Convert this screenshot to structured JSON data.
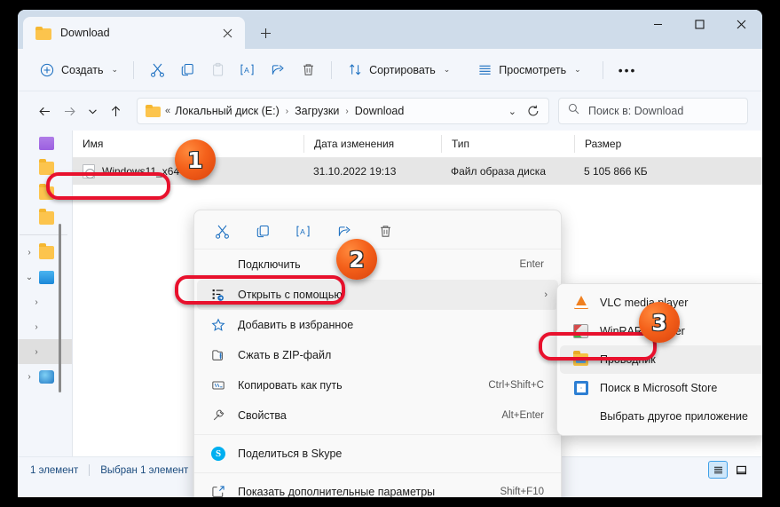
{
  "window": {
    "tab_title": "Download",
    "tab_close_label": "✕",
    "new_tab_label": "+",
    "minimize_label": "minimize",
    "maximize_label": "maximize",
    "close_label": "close"
  },
  "toolbar": {
    "new_label": "Создать",
    "cut_label": "cut-icon",
    "copy_label": "copy-icon",
    "paste_label": "paste-icon",
    "rename_label": "rename-icon",
    "share_label": "share-icon",
    "delete_label": "delete-icon",
    "sort_label": "Сортировать",
    "view_label": "Просмотреть",
    "more_label": "•••"
  },
  "address": {
    "crumbs": [
      "Локальный диск (E:)",
      "Загрузки",
      "Download"
    ],
    "overflow_label": "«",
    "separator": "›",
    "dropdown_caret": "⌄",
    "refresh_label": "refresh-icon"
  },
  "search": {
    "placeholder": "Поиск в: Download"
  },
  "columns": {
    "name": "Имя",
    "date": "Дата изменения",
    "type": "Тип",
    "size": "Размер"
  },
  "files": [
    {
      "name": "Windows11_x64",
      "date": "31.10.2022 19:13",
      "type": "Файл образа диска",
      "size": "5 105 866 КБ"
    }
  ],
  "context_menu": {
    "quick_actions": [
      "cut-icon",
      "copy-icon",
      "rename-icon",
      "share-icon",
      "delete-icon"
    ],
    "items": [
      {
        "label": "Подключить",
        "shortcut": "Enter",
        "icon": "",
        "arrow": "",
        "highlight": false
      },
      {
        "label": "Открыть с помощью",
        "shortcut": "",
        "icon": "open-with-icon",
        "arrow": "›",
        "highlight": true
      },
      {
        "label": "Добавить в избранное",
        "shortcut": "",
        "icon": "star-icon",
        "arrow": "",
        "highlight": false
      },
      {
        "label": "Сжать в ZIP-файл",
        "shortcut": "",
        "icon": "zip-icon",
        "arrow": "",
        "highlight": false
      },
      {
        "label": "Копировать как путь",
        "shortcut": "Ctrl+Shift+C",
        "icon": "path-icon",
        "arrow": "",
        "highlight": false
      },
      {
        "label": "Свойства",
        "shortcut": "Alt+Enter",
        "icon": "properties-icon",
        "arrow": "",
        "highlight": false
      },
      {
        "label": "Поделиться в Skype",
        "shortcut": "",
        "icon": "skype-icon",
        "arrow": "",
        "highlight": false
      },
      {
        "label": "Показать дополнительные параметры",
        "shortcut": "Shift+F10",
        "icon": "more-options-icon",
        "arrow": "",
        "highlight": false
      }
    ]
  },
  "submenu": {
    "items": [
      {
        "label": "VLC media player",
        "icon": "vlc-icon",
        "highlight": false
      },
      {
        "label": "WinRAR archiver",
        "icon": "winrar-icon",
        "highlight": false
      },
      {
        "label": "Проводник",
        "icon": "explorer-icon",
        "highlight": true
      },
      {
        "label": "Поиск в Microsoft Store",
        "icon": "store-icon",
        "highlight": false
      },
      {
        "label": "Выбрать другое приложение",
        "icon": "",
        "highlight": false
      }
    ]
  },
  "statusbar": {
    "count": "1 элемент",
    "selection": "Выбран 1 элемент",
    "details_view": "details-view-icon",
    "large_icons_view": "large-icons-view-icon"
  },
  "annotations": {
    "badges": [
      "1",
      "2",
      "3"
    ],
    "accent_color": "#e8112d",
    "badge_color": "#f4601a"
  }
}
